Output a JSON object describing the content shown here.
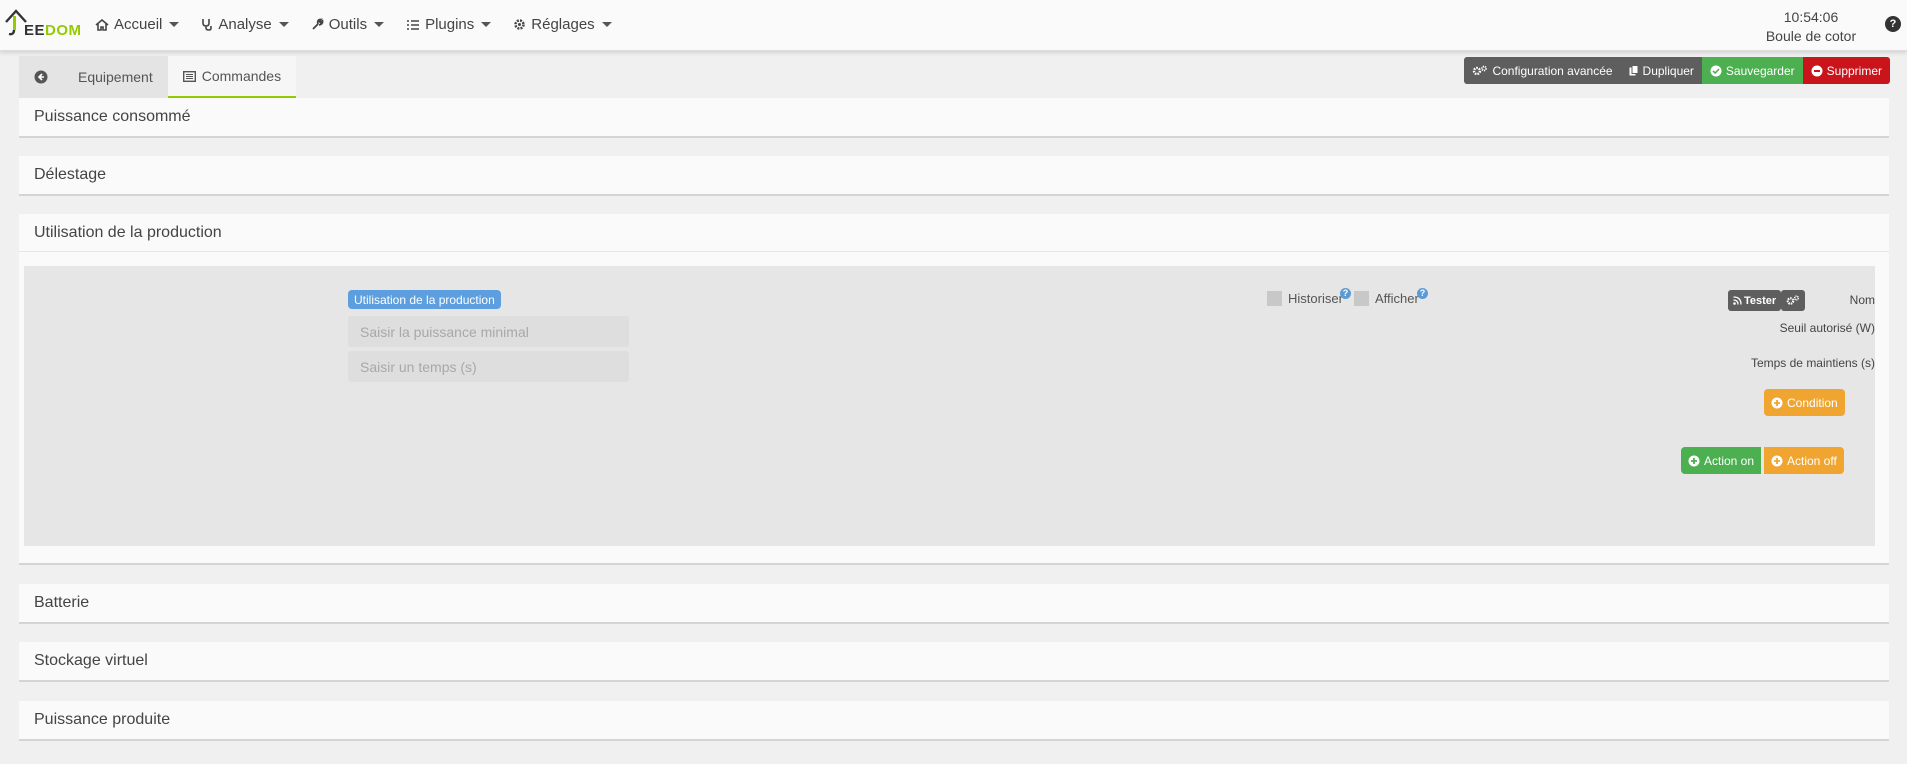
{
  "brand": {
    "logo_text_prefix": "EE",
    "logo_text_suffix": "DOM",
    "accent": "#94ca02"
  },
  "nav": {
    "items": [
      {
        "label": "Accueil",
        "icon": "home-icon"
      },
      {
        "label": "Analyse",
        "icon": "stethoscope-icon"
      },
      {
        "label": "Outils",
        "icon": "wrench-icon"
      },
      {
        "label": "Plugins",
        "icon": "list-icon"
      },
      {
        "label": "Réglages",
        "icon": "gear-icon"
      }
    ],
    "time": "10:54:06",
    "user": "Boule de cotor",
    "help": "?"
  },
  "tabs": {
    "back_icon": "arrow-circle-left-icon",
    "equipement": "Equipement",
    "commandes": "Commandes"
  },
  "actions": {
    "config": "Configuration avancée",
    "duplicate": "Dupliquer",
    "save": "Sauvegarder",
    "delete": "Supprimer",
    "colors": {
      "dark": "#5e5e5e",
      "green": "#4caf50",
      "red": "#c9141b"
    }
  },
  "panels": {
    "puissance_consommee": "Puissance consommé",
    "delestage": "Délestage",
    "utilisation": "Utilisation de la production",
    "batterie": "Batterie",
    "stockage": "Stockage virtuel",
    "puissance_produite": "Puissance produite"
  },
  "form": {
    "nom_label": "Nom",
    "nom_value": "Utilisation de la production",
    "seuil_label": "Seuil autorisé (W)",
    "seuil_placeholder": "Saisir la puissance minimal",
    "temps_label": "Temps de maintiens (s)",
    "temps_placeholder": "Saisir un temps (s)",
    "historiser": "Historiser",
    "afficher": "Afficher",
    "tester": "Tester",
    "condition": "Condition",
    "action_on": "Action on",
    "action_off": "Action off",
    "colors": {
      "orange": "#f0a530",
      "green": "#4caf50",
      "badge": "#5c9ede"
    }
  }
}
